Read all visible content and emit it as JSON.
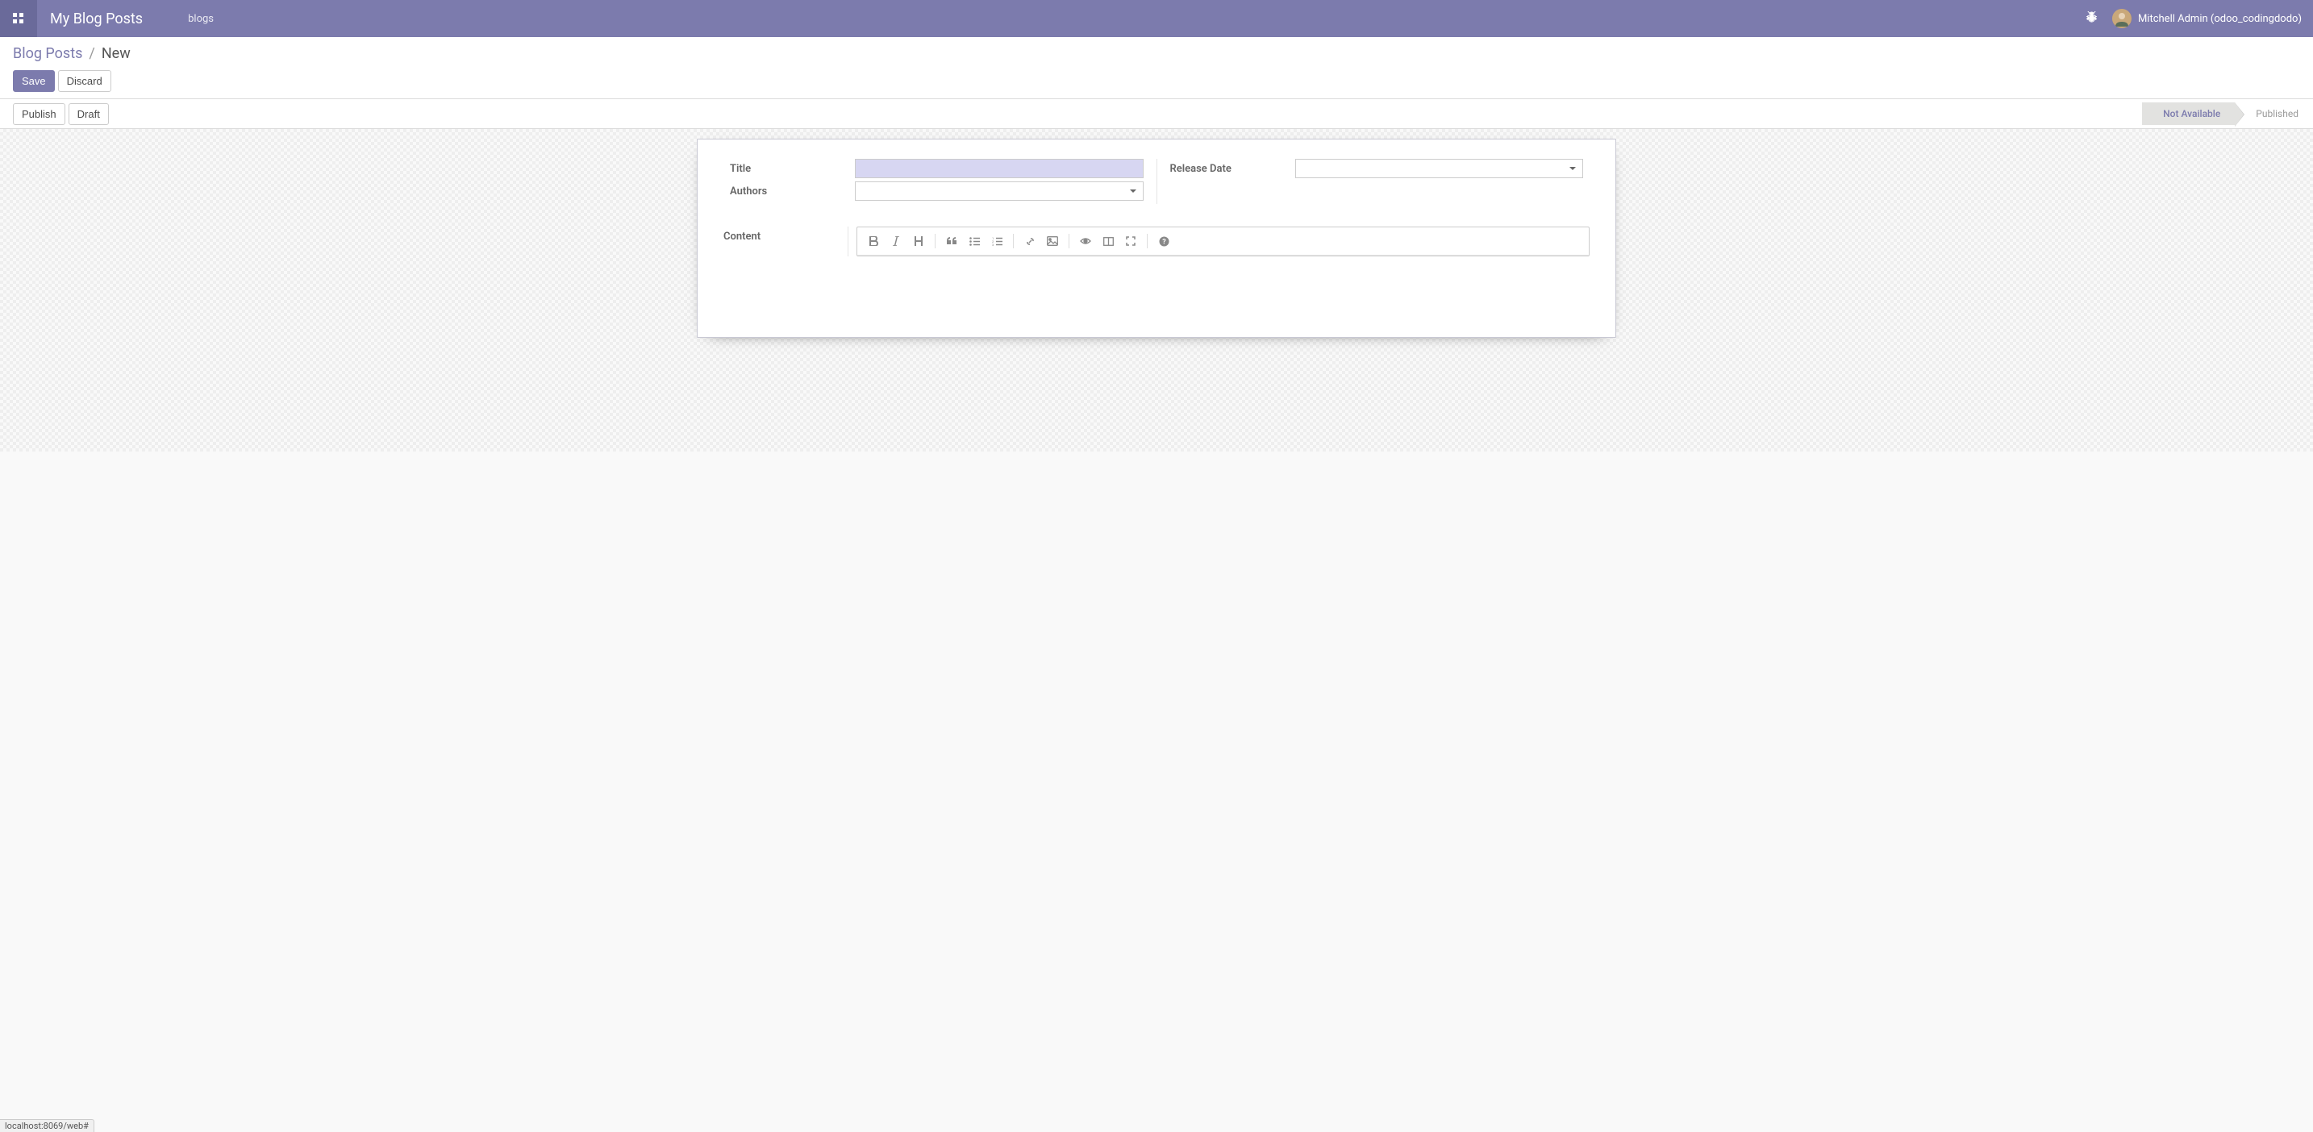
{
  "navbar": {
    "brand": "My Blog Posts",
    "menu_item": "blogs",
    "user_name": "Mitchell Admin (odoo_codingdodo)"
  },
  "breadcrumb": {
    "parent": "Blog Posts",
    "separator": "/",
    "current": "New"
  },
  "buttons": {
    "save": "Save",
    "discard": "Discard",
    "publish": "Publish",
    "draft": "Draft"
  },
  "status": {
    "not_available": "Not Available",
    "published": "Published"
  },
  "form": {
    "title_label": "Title",
    "authors_label": "Authors",
    "release_date_label": "Release Date",
    "content_label": "Content",
    "title_value": "",
    "authors_value": "",
    "release_date_value": ""
  },
  "editor_icons": {
    "bold": "bold-icon",
    "italic": "italic-icon",
    "heading": "heading-icon",
    "quote": "quote-icon",
    "ul": "unordered-list-icon",
    "ol": "ordered-list-icon",
    "link": "link-icon",
    "image": "image-icon",
    "preview": "preview-icon",
    "columns": "side-by-side-icon",
    "fullscreen": "fullscreen-icon",
    "help": "help-icon"
  },
  "footer": {
    "url": "localhost:8069/web#"
  }
}
